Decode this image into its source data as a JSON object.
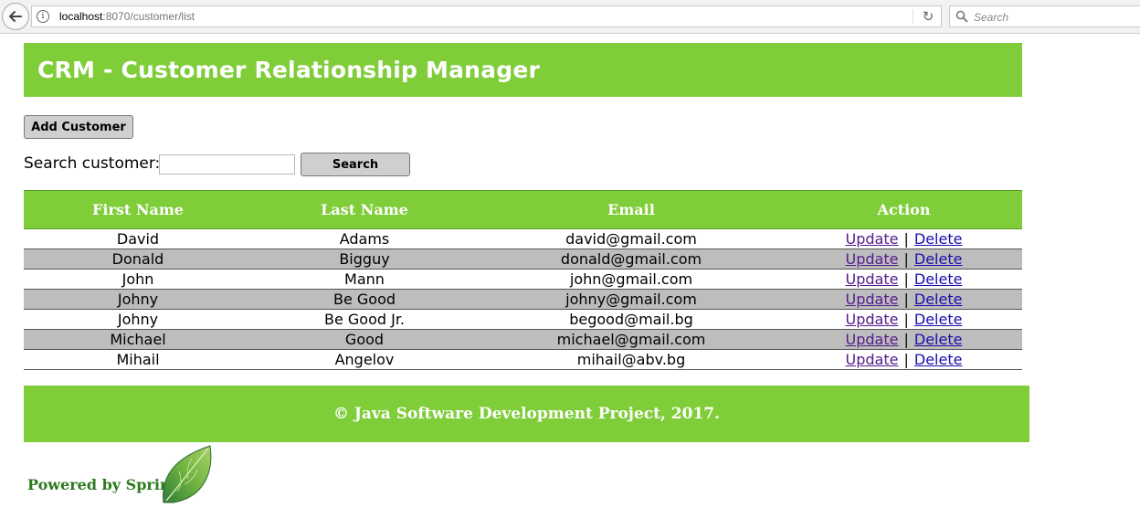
{
  "browser": {
    "url_host": "localhost",
    "url_path": ":8070/customer/list",
    "search_placeholder": "Search"
  },
  "header": {
    "title": "CRM - Customer Relationship Manager"
  },
  "toolbar": {
    "add_label": "Add Customer",
    "search_label": "Search customer:",
    "search_value": "",
    "search_button_label": "Search"
  },
  "table": {
    "columns": [
      "First Name",
      "Last Name",
      "Email",
      "Action"
    ],
    "update_label": "Update",
    "separator": "|",
    "delete_label": "Delete",
    "rows": [
      {
        "first": "David",
        "last": "Adams",
        "email": "david@gmail.com"
      },
      {
        "first": "Donald",
        "last": "Bigguy",
        "email": "donald@gmail.com"
      },
      {
        "first": "John",
        "last": "Mann",
        "email": "john@gmail.com"
      },
      {
        "first": "Johny",
        "last": "Be Good",
        "email": "johny@gmail.com"
      },
      {
        "first": "Johny",
        "last": "Be Good Jr.",
        "email": "begood@mail.bg"
      },
      {
        "first": "Michael",
        "last": "Good",
        "email": "michael@gmail.com"
      },
      {
        "first": "Mihail",
        "last": "Angelov",
        "email": "mihail@abv.bg"
      }
    ]
  },
  "footer": {
    "text": "© Java Software Development Project, 2017."
  },
  "branding": {
    "powered_by": "Powered by Spring",
    "leaf_icon": "spring-leaf-icon"
  },
  "colors": {
    "accent_green": "#80cd3a",
    "row_alt": "#bdbdbd",
    "link_visited": "#551a8b",
    "link": "#1a0dab"
  }
}
